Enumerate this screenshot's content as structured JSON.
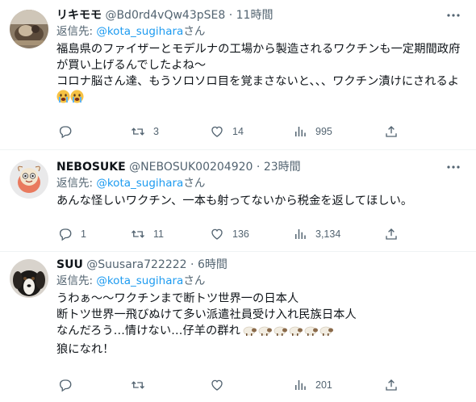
{
  "tweets": [
    {
      "name": "リキモモ",
      "handle": "@Bd0rd4vQw43pSE8",
      "dot": "·",
      "time": "11時間",
      "reply_prefix": "返信先: ",
      "reply_handle": "@kota_sugihara",
      "reply_suffix": "さん",
      "text": "福島県のファイザーとモデルナの工場から製造されるワクチンも一定期間政府が買い上げるんでしたよね〜\nコロナ脳さん達、もうソロソロ目を覚まさないと、、、ワクチン漬けにされるよ",
      "replies": "",
      "retweets": "3",
      "likes": "14",
      "views": "995",
      "avatar": "food-photo"
    },
    {
      "name": "NEBOSUKE",
      "handle": "@NEBOSUK00204920",
      "dot": "·",
      "time": "23時間",
      "reply_prefix": "返信先: ",
      "reply_handle": "@kota_sugihara",
      "reply_suffix": "さん",
      "text": "あんな怪しいワクチン、一本も射ってないから税金を返してほしい。",
      "replies": "1",
      "retweets": "11",
      "likes": "136",
      "views": "3,134",
      "avatar": "cartoon-character"
    },
    {
      "name": "SUU",
      "handle": "@Suusara722222",
      "dot": "·",
      "time": "6時間",
      "reply_prefix": "返信先: ",
      "reply_handle": "@kota_sugihara",
      "reply_suffix": "さん",
      "text_lines": [
        "うわぁ〜〜ワクチンまで断トツ世界一の日本人",
        "断トツ世界一飛びぬけて多い派遣社員受け入れ民族日本人",
        "なんだろう…情けない…仔羊の群れ",
        "狼になれ！"
      ],
      "replies": "",
      "retweets": "",
      "likes": "",
      "views": "201",
      "avatar": "dog-photo"
    }
  ],
  "colors": {
    "accent": "#1d9bf0",
    "secondary_text": "#536471",
    "divider": "#eff3f4"
  },
  "icons": [
    "more-icon",
    "reply-icon",
    "retweet-icon",
    "like-icon",
    "views-icon",
    "share-icon",
    "crying-face-emoji",
    "sheep-emoji"
  ]
}
